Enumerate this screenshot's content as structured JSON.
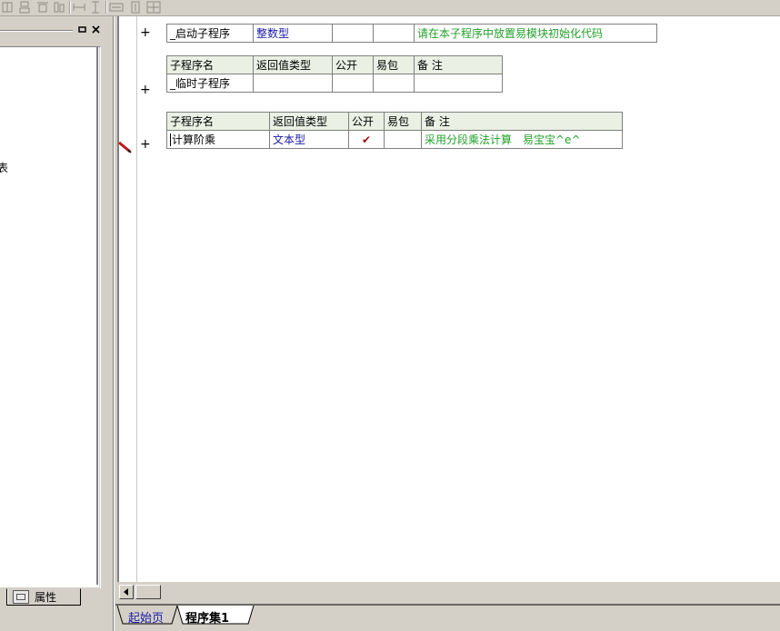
{
  "left_panel": {
    "clipped_text": "表",
    "properties_tab": "属性"
  },
  "routines": [
    {
      "name": "_启动子程序",
      "return_type": "整数型",
      "public": "",
      "ebao": "",
      "note": "请在本子程序中放置易模块初始化代码"
    },
    {
      "headers": [
        "子程序名",
        "返回值类型",
        "公开",
        "易包",
        "备 注"
      ],
      "name": "_临时子程序",
      "return_type": "",
      "public": "",
      "ebao": "",
      "note": ""
    },
    {
      "headers": [
        "子程序名",
        "返回值类型",
        "公开",
        "易包",
        "备 注"
      ],
      "name": "计算阶乘",
      "return_type": "文本型",
      "public": "✔",
      "ebao": "",
      "note": "采用分段乘法计算　易宝宝^e^"
    }
  ],
  "bottom_tabs": {
    "start_page": "起始页",
    "program_set": "程序集1"
  },
  "colors": {
    "header_bg": "#eaf0e4",
    "type_blue": "#1a1aa6",
    "note_green": "#22a02a",
    "check_red": "#a01010"
  }
}
